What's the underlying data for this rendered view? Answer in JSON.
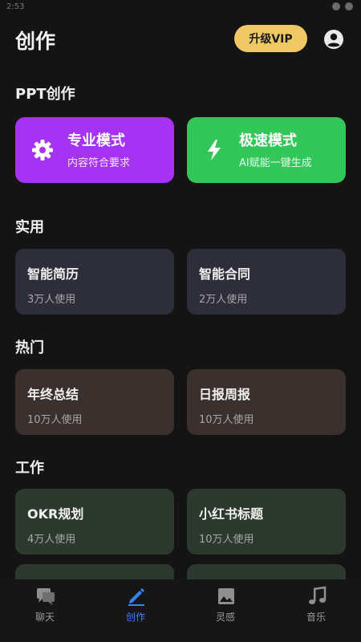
{
  "status": {
    "time": "2:53"
  },
  "header": {
    "title": "创作",
    "vip_label": "升级VIP"
  },
  "sections": {
    "ppt": "PPT创作",
    "practical": "实用",
    "popular": "热门",
    "work": "工作"
  },
  "modes": [
    {
      "title": "专业模式",
      "desc": "内容符合要求",
      "icon": "gear-icon",
      "color": "#a632f3"
    },
    {
      "title": "极速模式",
      "desc": "AI赋能一键生成",
      "icon": "lightning-icon",
      "color": "#33c759"
    }
  ],
  "practical_cards": [
    {
      "title": "智能简历",
      "usage": "3万人使用"
    },
    {
      "title": "智能合同",
      "usage": "2万人使用"
    }
  ],
  "popular_cards": [
    {
      "title": "年终总结",
      "usage": "10万人使用"
    },
    {
      "title": "日报周报",
      "usage": "10万人使用"
    }
  ],
  "work_cards": [
    {
      "title": "OKR规划",
      "usage": "4万人使用"
    },
    {
      "title": "小红书标题",
      "usage": "10万人使用"
    }
  ],
  "nav": [
    {
      "label": "聊天",
      "icon": "chat-icon"
    },
    {
      "label": "创作",
      "icon": "pencil-icon",
      "active": true
    },
    {
      "label": "灵感",
      "icon": "image-icon"
    },
    {
      "label": "音乐",
      "icon": "music-icon"
    }
  ],
  "colors": {
    "accent": "#3b82f6",
    "vip": "#f0c866",
    "background": "#141414"
  }
}
